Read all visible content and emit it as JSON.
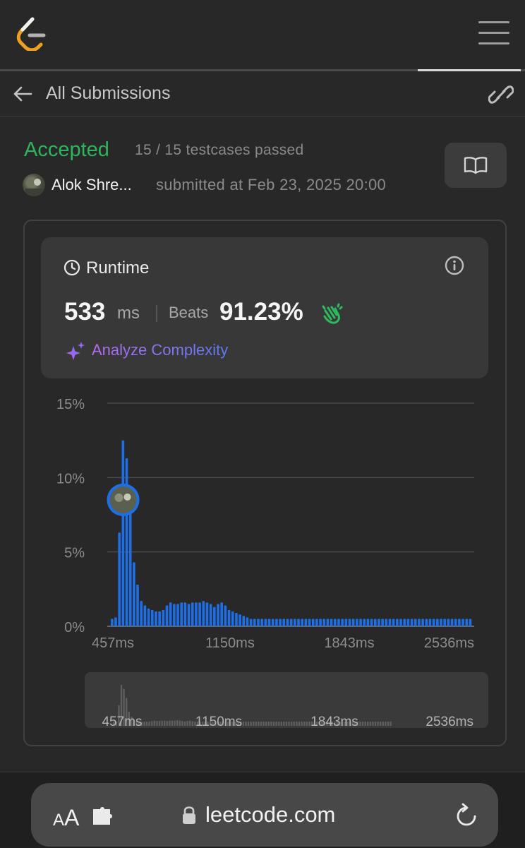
{
  "app": {
    "logo_icon": "leetcode-logo-icon",
    "menu_icon": "hamburger-menu-icon"
  },
  "subheader": {
    "title": "All Submissions",
    "back_icon": "arrow-left-icon",
    "share_icon": "link-icon"
  },
  "submission": {
    "status": "Accepted",
    "testcases": "15 / 15 testcases passed",
    "username": "Alok Shre...",
    "submitted": "submitted at Feb 23, 2025 20:00",
    "status_color": "#2db55d",
    "solution_icon": "book-open-icon"
  },
  "runtime": {
    "label": "Runtime",
    "value": "533",
    "unit": "ms",
    "beats_label": "Beats",
    "beats_value": "91.23%",
    "clap_icon": "clapping-hands-icon",
    "info_icon": "info-icon",
    "clock_icon": "clock-icon",
    "analyze_label": "Analyze Complexity",
    "analyze_icon": "sparkle-icon"
  },
  "chart_data": {
    "type": "bar",
    "x_tick_labels": [
      "457ms",
      "1150ms",
      "1843ms",
      "2536ms"
    ],
    "y_tick_labels": [
      "15%",
      "10%",
      "5%",
      "0%"
    ],
    "ylim": [
      0,
      15
    ],
    "x_range_ms": [
      457,
      2536
    ],
    "grid": true,
    "user_marker_ms": 533,
    "user_marker_pct": 8.5,
    "bar_color": "#1e6fe6",
    "values": [
      0.5,
      0.6,
      6.3,
      12.5,
      11.3,
      8.5,
      4.3,
      2.8,
      1.7,
      1.4,
      1.2,
      1.1,
      1.0,
      1.0,
      1.1,
      1.4,
      1.6,
      1.5,
      1.5,
      1.6,
      1.6,
      1.5,
      1.6,
      1.6,
      1.6,
      1.7,
      1.6,
      1.5,
      1.3,
      1.5,
      1.6,
      1.4,
      1.1,
      1.0,
      0.9,
      0.8,
      0.7,
      0.6,
      0.5,
      0.5,
      0.5,
      0.5,
      0.5,
      0.5,
      0.5,
      0.5,
      0.5,
      0.5,
      0.5,
      0.5,
      0.5,
      0.5,
      0.5,
      0.5,
      0.5,
      0.5,
      0.5,
      0.5,
      0.5,
      0.5,
      0.5,
      0.5,
      0.5,
      0.5,
      0.5,
      0.5,
      0.5,
      0.5,
      0.5,
      0.5,
      0.5,
      0.5,
      0.5,
      0.5,
      0.5,
      0.5,
      0.5,
      0.5,
      0.5,
      0.5,
      0.5,
      0.5,
      0.5,
      0.5,
      0.5,
      0.5,
      0.5,
      0.5,
      0.5,
      0.5,
      0.5,
      0.5,
      0.5,
      0.5,
      0.5,
      0.5,
      0.5,
      0.5,
      0.5,
      0.5,
      0.5,
      0.5,
      0.5,
      0.5,
      0.5,
      0.5,
      0.5,
      0.5,
      0.5,
      0.5
    ]
  },
  "mini_chart": {
    "x_tick_labels": [
      "457ms",
      "1150ms",
      "1843ms",
      "2536ms"
    ]
  },
  "browser": {
    "aa_small": "A",
    "aa_big": "A",
    "url": "leetcode.com",
    "extension_icon": "puzzle-piece-icon",
    "lock_icon": "lock-icon",
    "reload_icon": "reload-icon"
  }
}
